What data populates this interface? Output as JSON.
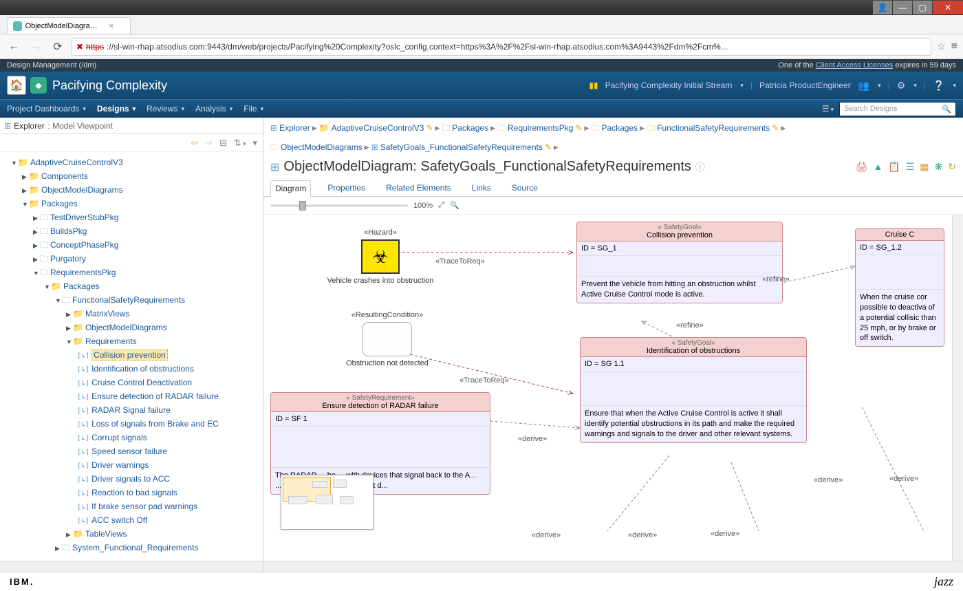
{
  "window": {
    "tab_title": "ObjectModelDiagram: Saf",
    "url_scheme": "https",
    "url_strike_prefix": "✗ ",
    "url_rest": "://sl-win-rhap.atsodius.com:9443/dm/web/projects/Pacifying%20Complexity?oslc_config.context=https%3A%2F%2Fsl-win-rhap.atsodius.com%3A9443%2Fdm%2Fcm%..."
  },
  "app_info": {
    "left": "Design Management (/dm)",
    "right_pre": "One of the ",
    "right_link": "Client Access Licenses",
    "right_post": " expires in 59 days"
  },
  "header": {
    "project": "Pacifying Complexity",
    "stream": "Pacifying Complexity Initial Stream",
    "user": "Patricia ProductEngineer"
  },
  "menu": {
    "items": [
      "Project Dashboards",
      "Designs",
      "Reviews",
      "Analysis",
      "File"
    ],
    "active_idx": 1,
    "search_placeholder": "Search Designs"
  },
  "sidebar": {
    "explorer": "Explorer",
    "viewpoint": "Model Viewpoint",
    "tree": {
      "root": "AdaptiveCruiseControlV3",
      "components": "Components",
      "omd": "ObjectModelDiagrams",
      "packages": "Packages",
      "pkg_children": [
        "TestDriverStubPkg",
        "BuildsPkg",
        "ConceptPhasePkg",
        "Purgatory",
        "RequirementsPkg"
      ],
      "req_packages": "Packages",
      "fsr": "FunctionalSafetyRequirements",
      "fsr_children": [
        "MatrixViews",
        "ObjectModelDiagrams",
        "Requirements"
      ],
      "requirements": [
        "Collision prevention",
        "Identification of obstructions",
        "Cruise Control Deactivation",
        "Ensure detection of RADAR failure",
        "RADAR Signal failure",
        "Loss of signals from Brake and EC",
        "Corrupt signals",
        "Speed sensor failure",
        "Driver warnings",
        "Driver signals to ACC",
        "Reaction to bad signals",
        "If brake sensor pad warnings",
        "ACC switch Off"
      ],
      "tableviews": "TableViews",
      "sfr": "System_Functional_Requirements"
    }
  },
  "breadcrumb": {
    "row1": [
      "Explorer",
      "AdaptiveCruiseControlV3",
      "Packages",
      "RequirementsPkg",
      "Packages",
      "FunctionalSafetyRequirements"
    ],
    "row2": [
      "ObjectModelDiagrams",
      "SafetyGoals_FunctionalSafetyRequirements"
    ]
  },
  "page": {
    "title": "ObjectModelDiagram: SafetyGoals_FunctionalSafetyRequirements",
    "tabs": [
      "Diagram",
      "Properties",
      "Related Elements",
      "Links",
      "Source"
    ],
    "active_tab": 0,
    "zoom": "100%"
  },
  "diagram": {
    "hazard": {
      "stereo": "«Hazard»",
      "caption": "Vehicle crashes into obstruction"
    },
    "condition": {
      "stereo": "«ResultingCondition»",
      "caption": "Obstruction not detected"
    },
    "trace1": "«TraceToReq»",
    "trace2": "«TraceToReq»",
    "refine1": "«refine»",
    "refine2": "«refine»",
    "derive": "«derive»",
    "sg1": {
      "stereo": "« SafetyGoal»",
      "name": "Collision prevention",
      "id": "ID = SG_1",
      "body": "Prevent the vehicle from hitting an obstruction whilst Active Cruise Control mode is active."
    },
    "sg11": {
      "stereo": "« SafetyGoal»",
      "name": "Identification of obstructions",
      "id": "ID = SG 1.1",
      "body": "Ensure that when the Active Cruise Control is active it shall identify potential obstructions in its path and make the required warnings and signals to the driver and other relevant systems."
    },
    "sg12": {
      "stereo": "",
      "name": "Cruise C",
      "id": "ID = SG_1.2",
      "body": "When the cruise cor possible to deactiva of a potential collisic than 25 mph,  or by brake or off switch."
    },
    "sreq": {
      "stereo": "« SafetyRequirement»",
      "name": "Ensure detection of RADAR failure",
      "id": "ID = SF 1",
      "body": "The RADAR ... be ... with devices that signal back to the A... ...he RADAR is incorrectly not d..."
    }
  },
  "footer": {
    "ibm": "IBM.",
    "jazz": "jazz"
  }
}
